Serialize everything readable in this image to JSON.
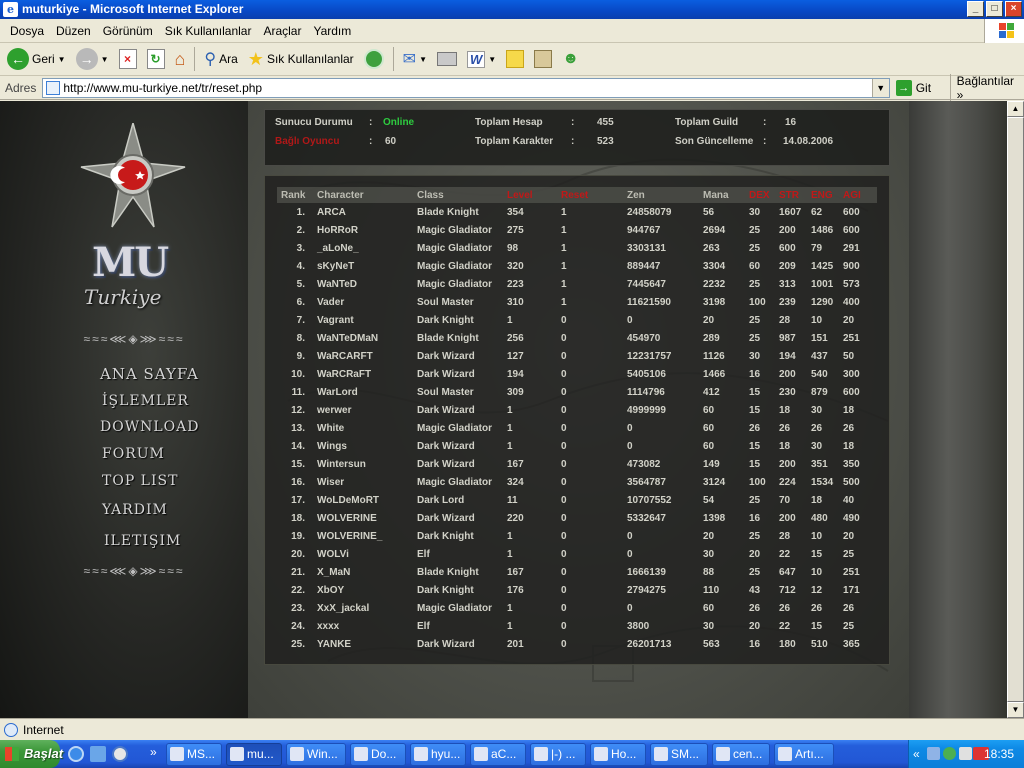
{
  "window": {
    "title": "muturkiye - Microsoft Internet Explorer"
  },
  "menu": [
    "Dosya",
    "Düzen",
    "Görünüm",
    "Sık Kullanılanlar",
    "Araçlar",
    "Yardım"
  ],
  "toolbar": {
    "back": "Geri",
    "search": "Ara",
    "favorites": "Sık Kullanılanlar"
  },
  "address": {
    "label": "Adres",
    "url": "http://www.mu-turkiye.net/tr/reset.php",
    "go": "Git",
    "links": "Bağlantılar"
  },
  "site": {
    "logo_main": "MU",
    "logo_sub": "Turkiye",
    "nav": [
      "ANA SAYFA",
      "İŞLEMLER",
      "DOWNLOAD",
      "FORUM",
      "TOP LIST",
      "YARDIM",
      "ILETIŞIM"
    ],
    "stats": {
      "server_status_label": "Sunucu Durumu",
      "server_status_value": "Online",
      "connected_label": "Bağlı Oyuncu",
      "connected_value": "60",
      "total_accounts_label": "Toplam Hesap",
      "total_accounts_value": "455",
      "total_chars_label": "Toplam Karakter",
      "total_chars_value": "523",
      "total_guild_label": "Toplam Guild",
      "total_guild_value": "16",
      "last_update_label": "Son Güncelleme",
      "last_update_value": "14.08.2006",
      "colon": ":"
    },
    "table": {
      "headers": [
        "Rank",
        "Character",
        "Class",
        "Level",
        "Reset",
        "Zen",
        "Mana",
        "DEX",
        "STR",
        "ENG",
        "AGI"
      ],
      "rows": [
        [
          "1.",
          "ARCA",
          "Blade Knight",
          "354",
          "1",
          "24858079",
          "56",
          "30",
          "1607",
          "62",
          "600"
        ],
        [
          "2.",
          "HoRRoR",
          "Magic Gladiator",
          "275",
          "1",
          "944767",
          "2694",
          "25",
          "200",
          "1486",
          "600"
        ],
        [
          "3.",
          "_aLoNe_",
          "Magic Gladiator",
          "98",
          "1",
          "3303131",
          "263",
          "25",
          "600",
          "79",
          "291"
        ],
        [
          "4.",
          "sKyNeT",
          "Magic Gladiator",
          "320",
          "1",
          "889447",
          "3304",
          "60",
          "209",
          "1425",
          "900"
        ],
        [
          "5.",
          "WaNTeD",
          "Magic Gladiator",
          "223",
          "1",
          "7445647",
          "2232",
          "25",
          "313",
          "1001",
          "573"
        ],
        [
          "6.",
          "Vader",
          "Soul Master",
          "310",
          "1",
          "11621590",
          "3198",
          "100",
          "239",
          "1290",
          "400"
        ],
        [
          "7.",
          "Vagrant",
          "Dark Knight",
          "1",
          "0",
          "0",
          "20",
          "25",
          "28",
          "10",
          "20"
        ],
        [
          "8.",
          "WaNTeDMaN",
          "Blade Knight",
          "256",
          "0",
          "454970",
          "289",
          "25",
          "987",
          "151",
          "251"
        ],
        [
          "9.",
          "WaRCARFT",
          "Dark Wizard",
          "127",
          "0",
          "12231757",
          "1126",
          "30",
          "194",
          "437",
          "50"
        ],
        [
          "10.",
          "WaRCRaFT",
          "Dark Wizard",
          "194",
          "0",
          "5405106",
          "1466",
          "16",
          "200",
          "540",
          "300"
        ],
        [
          "11.",
          "WarLord",
          "Soul Master",
          "309",
          "0",
          "1114796",
          "412",
          "15",
          "230",
          "879",
          "600"
        ],
        [
          "12.",
          "werwer",
          "Dark Wizard",
          "1",
          "0",
          "4999999",
          "60",
          "15",
          "18",
          "30",
          "18"
        ],
        [
          "13.",
          "White",
          "Magic Gladiator",
          "1",
          "0",
          "0",
          "60",
          "26",
          "26",
          "26",
          "26"
        ],
        [
          "14.",
          "Wings",
          "Dark Wizard",
          "1",
          "0",
          "0",
          "60",
          "15",
          "18",
          "30",
          "18"
        ],
        [
          "15.",
          "Wintersun",
          "Dark Wizard",
          "167",
          "0",
          "473082",
          "149",
          "15",
          "200",
          "351",
          "350"
        ],
        [
          "16.",
          "Wiser",
          "Magic Gladiator",
          "324",
          "0",
          "3564787",
          "3124",
          "100",
          "224",
          "1534",
          "500"
        ],
        [
          "17.",
          "WoLDeMoRT",
          "Dark Lord",
          "11",
          "0",
          "10707552",
          "54",
          "25",
          "70",
          "18",
          "40"
        ],
        [
          "18.",
          "WOLVERINE",
          "Dark Wizard",
          "220",
          "0",
          "5332647",
          "1398",
          "16",
          "200",
          "480",
          "490"
        ],
        [
          "19.",
          "WOLVERINE_",
          "Dark Knight",
          "1",
          "0",
          "0",
          "20",
          "25",
          "28",
          "10",
          "20"
        ],
        [
          "20.",
          "WOLVi",
          "Elf",
          "1",
          "0",
          "0",
          "30",
          "20",
          "22",
          "15",
          "25"
        ],
        [
          "21.",
          "X_MaN",
          "Blade Knight",
          "167",
          "0",
          "1666139",
          "88",
          "25",
          "647",
          "10",
          "251"
        ],
        [
          "22.",
          "XbOY",
          "Dark Knight",
          "176",
          "0",
          "2794275",
          "110",
          "43",
          "712",
          "12",
          "171"
        ],
        [
          "23.",
          "XxX_jackal",
          "Magic Gladiator",
          "1",
          "0",
          "0",
          "60",
          "26",
          "26",
          "26",
          "26"
        ],
        [
          "24.",
          "xxxx",
          "Elf",
          "1",
          "0",
          "3800",
          "30",
          "20",
          "22",
          "15",
          "25"
        ],
        [
          "25.",
          "YANKE",
          "Dark Wizard",
          "201",
          "0",
          "26201713",
          "563",
          "16",
          "180",
          "510",
          "365"
        ]
      ]
    }
  },
  "status": {
    "zone": "Internet"
  },
  "taskbar": {
    "start": "Başlat",
    "buttons": [
      "MS...",
      "mu...",
      "Win...",
      "Do...",
      "hyu...",
      "aC...",
      "|-) ...",
      "Ho...",
      "SM...",
      "cen...",
      "Artı..."
    ],
    "clock": "18:35"
  },
  "colors": {
    "online": "#2ecc40",
    "red_header": "#c01818",
    "xp_blue": "#245edb"
  }
}
